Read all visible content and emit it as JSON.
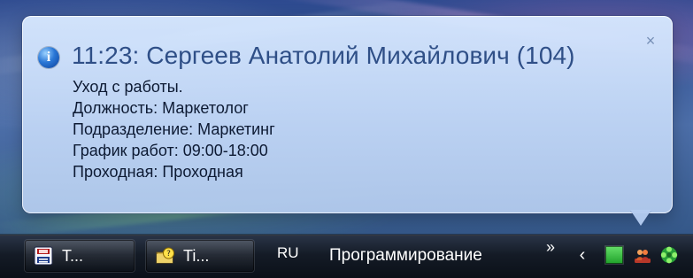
{
  "notification": {
    "title": "11:23: Сергеев Анатолий Михайлович (104)",
    "close_glyph": "×",
    "lines": [
      "Уход с работы.",
      "Должность: Маркетолог",
      "Подразделение: Маркетинг",
      "График работ: 09:00-18:00",
      "Проходная: Проходная"
    ],
    "icon": "info-icon"
  },
  "taskbar": {
    "buttons": [
      {
        "label": "T...",
        "icon": "floppy-app-icon"
      },
      {
        "label": "Ti...",
        "icon": "folder-help-app-icon"
      }
    ],
    "language": "RU",
    "toolbar_label": "Программирование",
    "overflow_glyph": "»",
    "tray_expand_glyph": "‹",
    "tray_icons": [
      "green-square-tray-icon",
      "people-tray-icon",
      "green-flower-tray-icon"
    ]
  },
  "colors": {
    "balloon_title": "#2f4f87",
    "balloon_text": "#0d1a33",
    "taskbar": "#141b26"
  }
}
